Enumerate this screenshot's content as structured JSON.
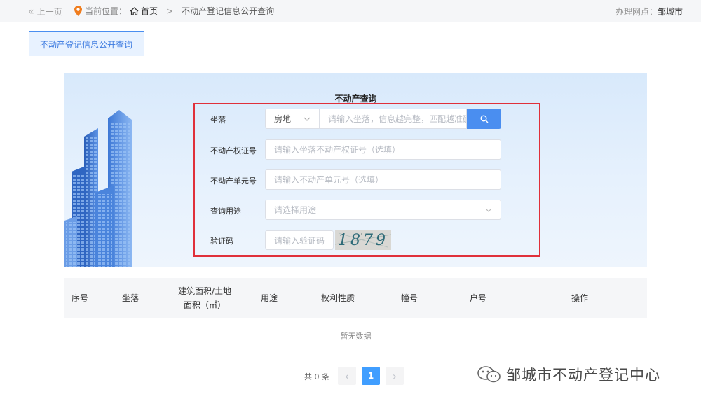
{
  "topbar": {
    "back_label": "上一页",
    "location_label": "当前位置：",
    "home_label": "首页",
    "separator": ">",
    "current_crumb": "不动产登记信息公开查询",
    "site_label": "办理网点：",
    "site_value": "邹城市"
  },
  "tab": {
    "label": "不动产登记信息公开查询"
  },
  "form": {
    "title": "不动产查询",
    "address_label": "坐落",
    "address_type": "房地",
    "address_placeholder": "请输入坐落，信息越完整，匹配越准确",
    "cert_label": "不动产权证号",
    "cert_placeholder": "请输入坐落不动产权证号（选填）",
    "unit_label": "不动产单元号",
    "unit_placeholder": "请输入不动产单元号（选填）",
    "usage_label": "查询用途",
    "usage_placeholder": "请选择用途",
    "captcha_label": "验证码",
    "captcha_placeholder": "请输入验证码",
    "captcha_text": "1879",
    "highlight_color": "#e0303a"
  },
  "table": {
    "headers": [
      "序号",
      "坐落",
      "建筑面积/土地",
      "面积（㎡）",
      "用途",
      "权利性质",
      "幢号",
      "户号",
      "操作"
    ],
    "empty_text": "暂无数据"
  },
  "pagination": {
    "total_label": "共 0 条",
    "current_page": "1",
    "prev_icon": "‹",
    "next_icon": "›"
  },
  "watermark": {
    "text": "邹城市不动产登记中心"
  },
  "colors": {
    "accent": "#4a8ef0",
    "page_active": "#409eff"
  }
}
